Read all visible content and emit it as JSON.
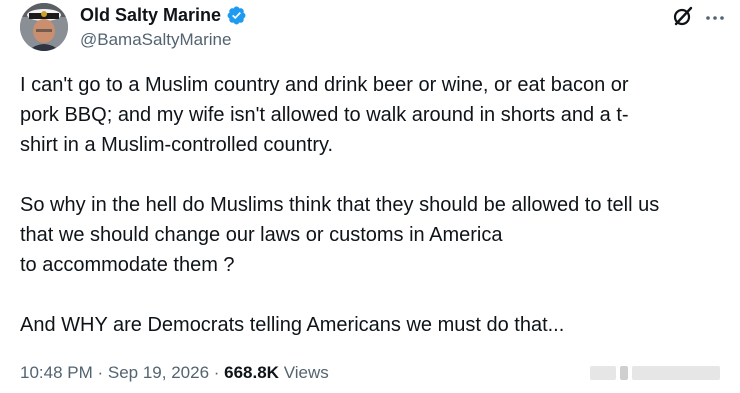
{
  "author": {
    "display_name": "Old Salty Marine",
    "handle": "@BamaSaltyMarine",
    "verified": true,
    "verified_color": "#1d9bf0"
  },
  "actions": {
    "grok_icon": "grok-icon",
    "more_icon": "more-horizontal-icon"
  },
  "tweet": {
    "paragraphs": [
      "I can't go to a Muslim country and drink beer or wine, or eat bacon or\npork BBQ; and my wife isn't allowed to walk around in shorts and a t-\nshirt in a Muslim-controlled country.",
      "So why in the hell do Muslims think that they should be allowed to tell us\nthat we should change our laws or customs in America\nto accommodate them ?",
      "And WHY are Democrats telling Americans we must do that..."
    ]
  },
  "meta": {
    "time": "10:48 PM",
    "separator": " · ",
    "date": "Sep 19, 2026",
    "views_count": "668.8K",
    "views_label": "Views"
  },
  "colors": {
    "text_primary": "#0f1419",
    "text_secondary": "#536471"
  }
}
